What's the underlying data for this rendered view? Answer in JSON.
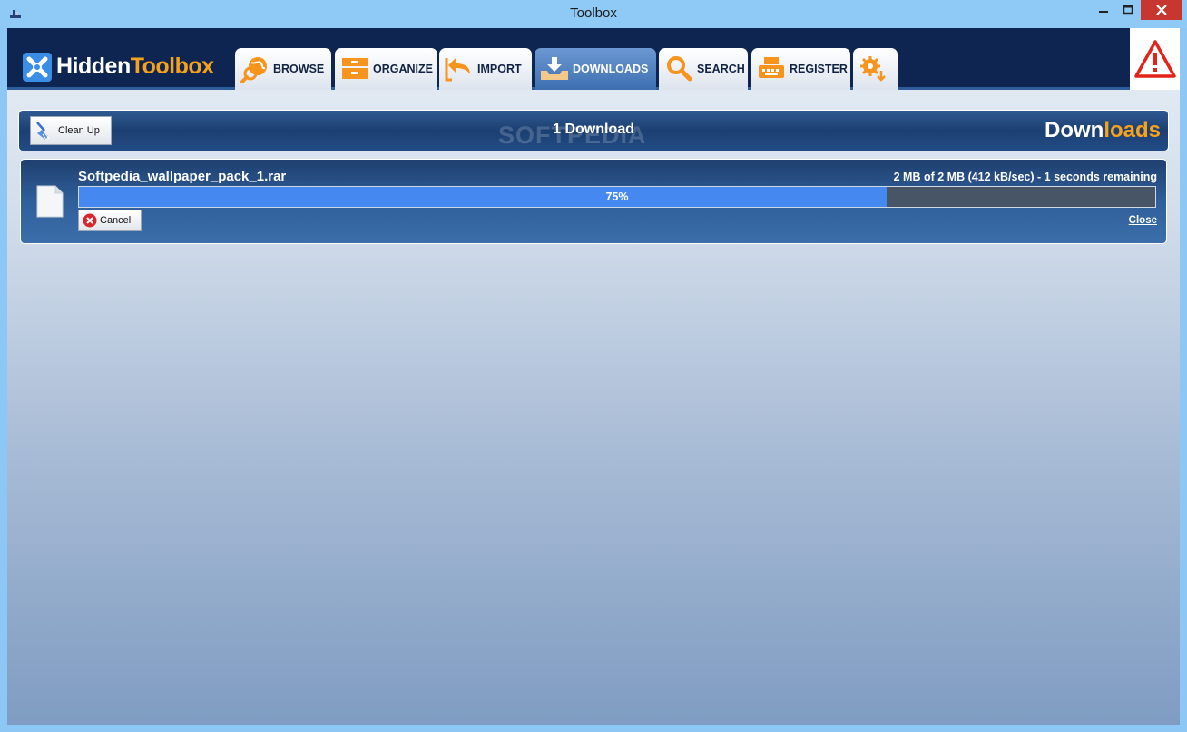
{
  "window": {
    "title": "Toolbox"
  },
  "brand": {
    "name_primary": "Hidden",
    "name_accent": "Toolbox"
  },
  "tabs": [
    {
      "id": "browse",
      "label": "BROWSE",
      "icon": "globe-search-icon",
      "active": false
    },
    {
      "id": "organize",
      "label": "ORGANIZE",
      "icon": "cabinet-icon",
      "active": false
    },
    {
      "id": "import",
      "label": "IMPORT",
      "icon": "import-arrow-icon",
      "active": false
    },
    {
      "id": "downloads",
      "label": "DOWNLOADS",
      "icon": "download-tray-icon",
      "active": true
    },
    {
      "id": "search",
      "label": "SEARCH",
      "icon": "magnifier-icon",
      "active": false
    },
    {
      "id": "register",
      "label": "REGISTER",
      "icon": "typewriter-icon",
      "active": false
    },
    {
      "id": "settings",
      "label": "",
      "icon": "gears-icon",
      "active": false
    }
  ],
  "toolbar": {
    "cleanup_label": "Clean Up",
    "count_label": "1 Download",
    "title_primary": "Down",
    "title_accent": "loads",
    "watermark": "SOFTPEDIA"
  },
  "download": {
    "file_name": "Softpedia_wallpaper_pack_1.rar",
    "status": "2 MB of 2 MB (412 kB/sec) - 1 seconds remaining",
    "progress_percent": 75,
    "progress_label": "75%",
    "cancel_label": "Cancel",
    "close_label": "Close"
  },
  "colors": {
    "accent": "#f7a21b",
    "header_bg": "#0f2551",
    "progress_fill": "#4488f0"
  }
}
